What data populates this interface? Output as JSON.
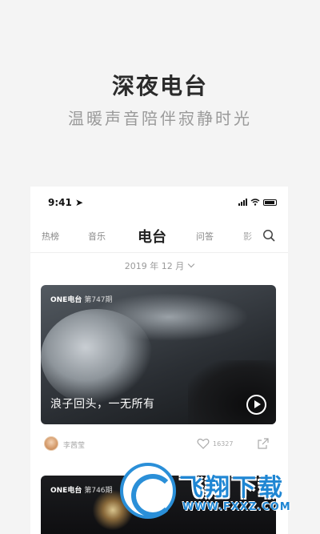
{
  "promo": {
    "title": "深夜电台",
    "subtitle": "温暖声音陪伴寂静时光"
  },
  "status_bar": {
    "time": "9:41 ➤"
  },
  "tabs": [
    {
      "label": "热榜",
      "active": false
    },
    {
      "label": "音乐",
      "active": false
    },
    {
      "label": "电台",
      "active": true
    },
    {
      "label": "问答",
      "active": false
    },
    {
      "label": "影",
      "active": false
    }
  ],
  "month_picker": {
    "label": "2019 年 12 月"
  },
  "cards": [
    {
      "brand": "ONE电台",
      "issue": "第747期",
      "title": "浪子回头，一无所有",
      "author": "李茜莹",
      "likes": "16327"
    },
    {
      "brand": "ONE电台",
      "issue": "第746期"
    }
  ],
  "watermark": {
    "title": "飞翔下载",
    "url": "WWW.FXXZ.COM"
  },
  "colors": {
    "accent": "#1f86d3",
    "background": "#f4f4f4"
  }
}
